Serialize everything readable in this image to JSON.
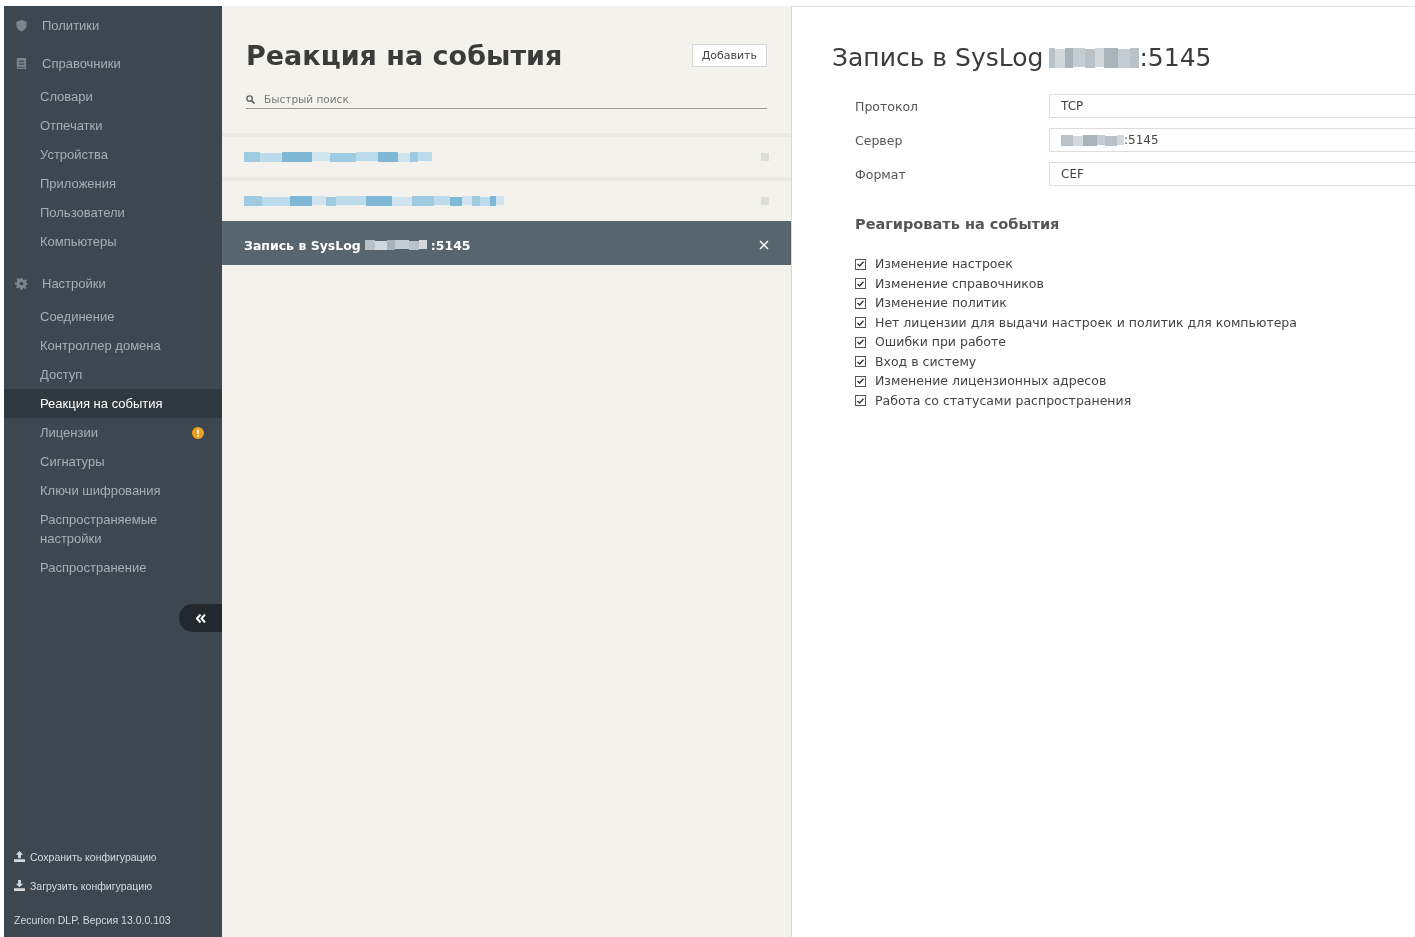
{
  "sidebar": {
    "groups": [
      {
        "kind": "shield",
        "label": "Политики"
      },
      {
        "kind": "book",
        "label": "Справочники",
        "items": [
          {
            "label": "Словари",
            "selected": false,
            "alert": false
          },
          {
            "label": "Отпечатки",
            "selected": false,
            "alert": false
          },
          {
            "label": "Устройства",
            "selected": false,
            "alert": false
          },
          {
            "label": "Приложения",
            "selected": false,
            "alert": false
          },
          {
            "label": "Пользователи",
            "selected": false,
            "alert": false
          },
          {
            "label": "Компьютеры",
            "selected": false,
            "alert": false
          }
        ]
      },
      {
        "kind": "gear",
        "label": "Настройки",
        "items": [
          {
            "label": "Соединение",
            "selected": false,
            "alert": false
          },
          {
            "label": "Контроллер домена",
            "selected": false,
            "alert": false
          },
          {
            "label": "Доступ",
            "selected": false,
            "alert": false
          },
          {
            "label": "Реакция на события",
            "selected": true,
            "alert": false
          },
          {
            "label": "Лицензии",
            "selected": false,
            "alert": true
          },
          {
            "label": "Сигнатуры",
            "selected": false,
            "alert": false
          },
          {
            "label": "Ключи шифрования",
            "selected": false,
            "alert": false
          },
          {
            "label": "Распространяемые настройки",
            "selected": false,
            "alert": false
          },
          {
            "label": "Распространение",
            "selected": false,
            "alert": false
          }
        ]
      }
    ],
    "actions": [
      {
        "kind": "upload",
        "label": "Сохранить конфигурацию"
      },
      {
        "kind": "download",
        "label": "Загрузить конфигурацию"
      }
    ],
    "version": "Zecurion DLP. Версия 13.0.0.103"
  },
  "list_panel": {
    "title": "Реакция на события",
    "add_button": "Добавить",
    "search": {
      "placeholder": "Быстрый поиск"
    },
    "items": [
      {
        "kind": "redacted",
        "selected": false
      },
      {
        "kind": "redacted",
        "selected": false
      },
      {
        "kind": "text",
        "prefix": "Запись в SysLog",
        "suffix": ":5145",
        "selected": true
      }
    ]
  },
  "detail": {
    "title_prefix": "Запись в SysLog",
    "title_suffix": ":5145",
    "fields": [
      {
        "label": "Протокол",
        "value": "TCP",
        "redacted": false
      },
      {
        "label": "Сервер",
        "value": ":5145",
        "redacted": true
      },
      {
        "label": "Формат",
        "value": "CEF",
        "redacted": false
      }
    ],
    "events_title": "Реагировать на события",
    "events": [
      {
        "label": "Изменение настроек",
        "checked": true
      },
      {
        "label": "Изменение справочников",
        "checked": true
      },
      {
        "label": "Изменение политик",
        "checked": true
      },
      {
        "label": "Нет лицензии для выдачи настроек и политик для компьютера",
        "checked": true
      },
      {
        "label": "Ошибки при работе",
        "checked": true
      },
      {
        "label": "Вход в систему",
        "checked": true
      },
      {
        "label": "Изменение лицензионных адресов",
        "checked": true
      },
      {
        "label": "Работа со статусами распространения",
        "checked": true
      }
    ]
  }
}
